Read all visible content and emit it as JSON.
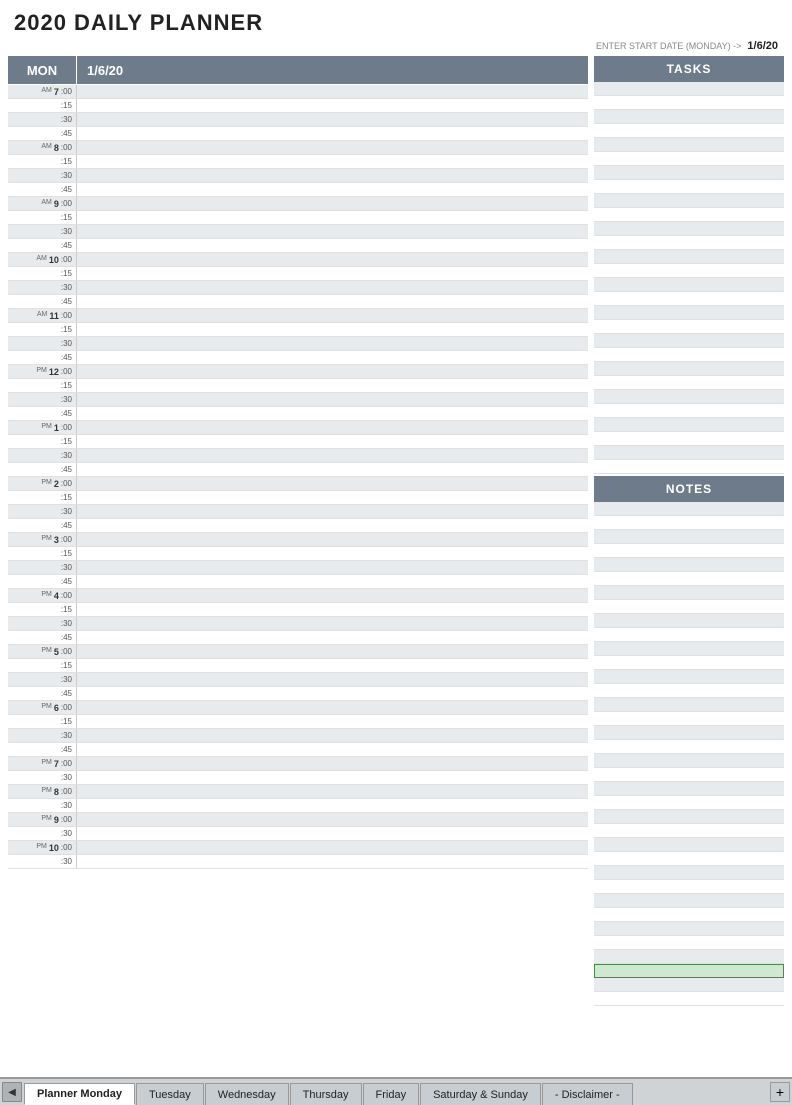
{
  "title": "2020 DAILY PLANNER",
  "startDateLabel": "ENTER START DATE (MONDAY) ->",
  "startDateValue": "1/6/20",
  "header": {
    "day": "MON",
    "date": "1/6/20"
  },
  "tasksLabel": "TASKS",
  "notesLabel": "NOTES",
  "timeSlots": [
    {
      "hour": "7",
      "ampm": "AM",
      "slots": [
        ":00",
        ":15",
        ":30",
        ":45"
      ]
    },
    {
      "hour": "8",
      "ampm": "AM",
      "slots": [
        ":00",
        ":15",
        ":30",
        ":45"
      ]
    },
    {
      "hour": "9",
      "ampm": "AM",
      "slots": [
        ":00",
        ":15",
        ":30",
        ":45"
      ]
    },
    {
      "hour": "10",
      "ampm": "AM",
      "slots": [
        ":00",
        ":15",
        ":30",
        ":45"
      ]
    },
    {
      "hour": "11",
      "ampm": "AM",
      "slots": [
        ":00",
        ":15",
        ":30",
        ":45"
      ]
    },
    {
      "hour": "12",
      "ampm": "PM",
      "slots": [
        ":00",
        ":15",
        ":30",
        ":45"
      ]
    },
    {
      "hour": "1",
      "ampm": "PM",
      "slots": [
        ":00",
        ":15",
        ":30",
        ":45"
      ]
    },
    {
      "hour": "2",
      "ampm": "PM",
      "slots": [
        ":00",
        ":15",
        ":30",
        ":45"
      ]
    },
    {
      "hour": "3",
      "ampm": "PM",
      "slots": [
        ":00",
        ":15",
        ":30",
        ":45"
      ]
    },
    {
      "hour": "4",
      "ampm": "PM",
      "slots": [
        ":00",
        ":15",
        ":30",
        ":45"
      ]
    },
    {
      "hour": "5",
      "ampm": "PM",
      "slots": [
        ":00",
        ":15",
        ":30",
        ":45"
      ]
    },
    {
      "hour": "6",
      "ampm": "PM",
      "slots": [
        ":00",
        ":15",
        ":30",
        ":45"
      ]
    },
    {
      "hour": "7",
      "ampm": "PM",
      "slots": [
        ":00",
        ":30"
      ]
    },
    {
      "hour": "8",
      "ampm": "PM",
      "slots": [
        ":00",
        ":30"
      ]
    },
    {
      "hour": "9",
      "ampm": "PM",
      "slots": [
        ":00",
        ":30"
      ]
    },
    {
      "hour": "10",
      "ampm": "PM",
      "slots": [
        ":00",
        ":30"
      ]
    }
  ],
  "tabs": [
    {
      "label": "Planner Monday",
      "active": true
    },
    {
      "label": "Tuesday",
      "active": false
    },
    {
      "label": "Wednesday",
      "active": false
    },
    {
      "label": "Thursday",
      "active": false
    },
    {
      "label": "Friday",
      "active": false
    },
    {
      "label": "Saturday & Sunday",
      "active": false
    },
    {
      "label": "- Disclaimer -",
      "active": false
    }
  ]
}
